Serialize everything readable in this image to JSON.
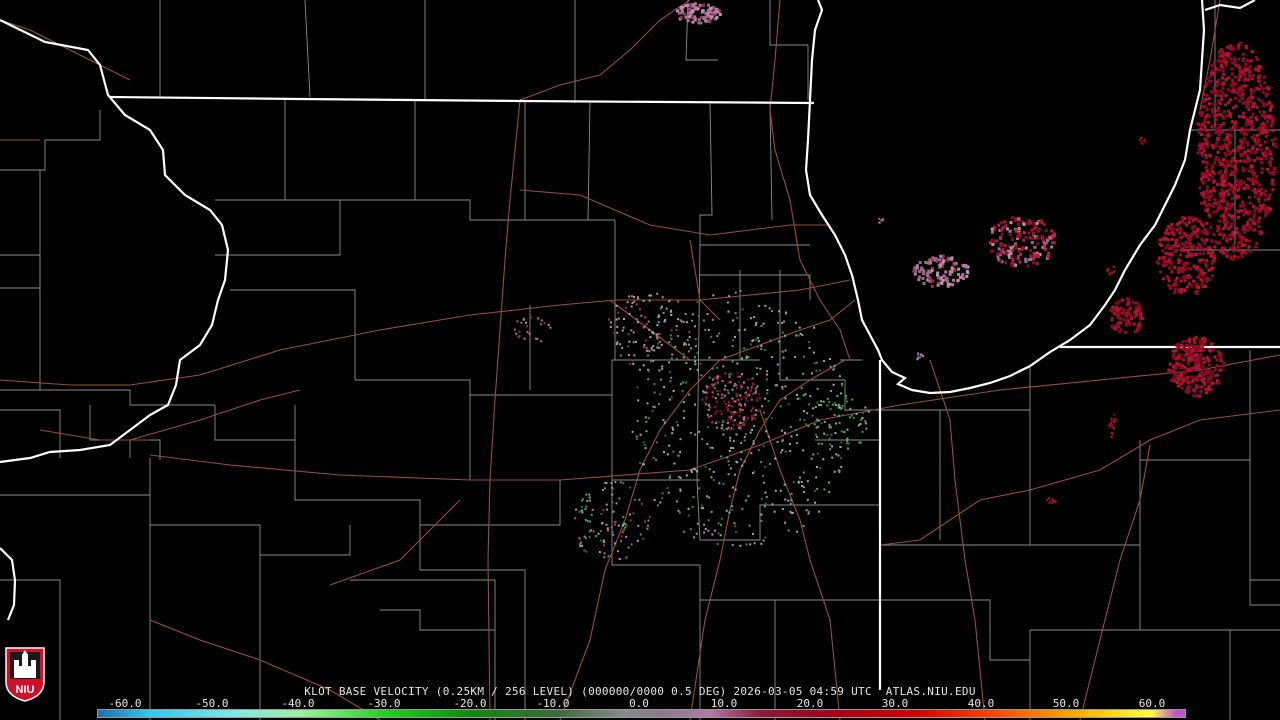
{
  "product": {
    "caption": "KLOT BASE VELOCITY (0.25KM / 256 LEVEL) (000000/0000 0.5 DEG) 2026-03-05 04:59 UTC  ATLAS.NIU.EDU"
  },
  "logo": {
    "text": "NIU"
  },
  "colorbar": {
    "ticks": [
      "-60.0",
      "-50.0",
      "-40.0",
      "-30.0",
      "-20.0",
      "-10.0",
      "0.0",
      "10.0",
      "20.0",
      "30.0",
      "40.0",
      "50.0",
      "60.0"
    ],
    "min": -64,
    "max": 64,
    "stops": [
      {
        "v": -64,
        "c": "#1e6fb0"
      },
      {
        "v": -58,
        "c": "#2ec7ee"
      },
      {
        "v": -48,
        "c": "#7fe7e7"
      },
      {
        "v": -40,
        "c": "#9cf29c"
      },
      {
        "v": -30,
        "c": "#1ed21e"
      },
      {
        "v": -20,
        "c": "#0d8a0d"
      },
      {
        "v": -10,
        "c": "#3d6a3d"
      },
      {
        "v": -2,
        "c": "#8a8a8a"
      },
      {
        "v": 2,
        "c": "#8a7a8a"
      },
      {
        "v": 8,
        "c": "#b07aa8"
      },
      {
        "v": 14,
        "c": "#8a1a3a"
      },
      {
        "v": 22,
        "c": "#a3001a"
      },
      {
        "v": 32,
        "c": "#d00000"
      },
      {
        "v": 42,
        "c": "#ff4a00"
      },
      {
        "v": 52,
        "c": "#ffb400"
      },
      {
        "v": 60,
        "c": "#ffff40"
      },
      {
        "v": 63,
        "c": "#c050d0"
      }
    ]
  }
}
